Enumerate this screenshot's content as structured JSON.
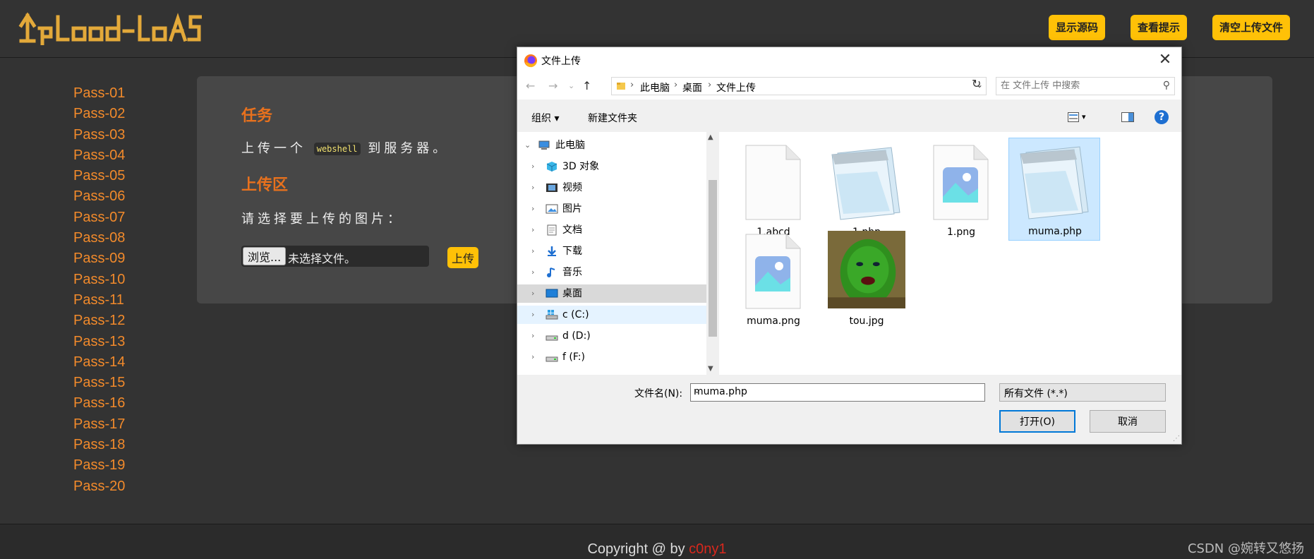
{
  "page": {
    "logo_text": "Upload-labs",
    "header_buttons": [
      "显示源码",
      "查看提示",
      "清空上传文件"
    ],
    "nav": [
      "Pass-01",
      "Pass-02",
      "Pass-03",
      "Pass-04",
      "Pass-05",
      "Pass-06",
      "Pass-07",
      "Pass-08",
      "Pass-09",
      "Pass-10",
      "Pass-11",
      "Pass-12",
      "Pass-13",
      "Pass-14",
      "Pass-15",
      "Pass-16",
      "Pass-17",
      "Pass-18",
      "Pass-19",
      "Pass-20"
    ],
    "task_heading": "任务",
    "task_before": "上传一个",
    "task_code": "webshell",
    "task_after": "到服务器。",
    "upload_heading": "上传区",
    "upload_prompt": "请选择要上传的图片：",
    "browse_label": "浏览...",
    "no_file": "未选择文件。",
    "upload_button": "上传",
    "copyright_prefix": "Copyright @  by ",
    "copyright_author": "c0ny1",
    "watermark": "CSDN @婉转又悠扬"
  },
  "dialog": {
    "title": "文件上传",
    "breadcrumb": [
      "此电脑",
      "桌面",
      "文件上传"
    ],
    "search_placeholder": "在 文件上传 中搜索",
    "toolbar": {
      "organize": "组织 ▾",
      "new_folder": "新建文件夹"
    },
    "tree": [
      {
        "label": "此电脑",
        "icon": "computer-icon",
        "level": 0,
        "state": ""
      },
      {
        "label": "3D 对象",
        "icon": "cube-icon",
        "level": 1,
        "state": ""
      },
      {
        "label": "视频",
        "icon": "video-icon",
        "level": 1,
        "state": ""
      },
      {
        "label": "图片",
        "icon": "picture-icon",
        "level": 1,
        "state": ""
      },
      {
        "label": "文档",
        "icon": "document-icon",
        "level": 1,
        "state": ""
      },
      {
        "label": "下载",
        "icon": "download-icon",
        "level": 1,
        "state": ""
      },
      {
        "label": "音乐",
        "icon": "music-icon",
        "level": 1,
        "state": ""
      },
      {
        "label": "桌面",
        "icon": "desktop-icon",
        "level": 1,
        "state": "selected"
      },
      {
        "label": "c (C:)",
        "icon": "windows-drive-icon",
        "level": 1,
        "state": "hover"
      },
      {
        "label": "d (D:)",
        "icon": "drive-icon",
        "level": 1,
        "state": ""
      },
      {
        "label": "f (F:)",
        "icon": "drive-icon",
        "level": 1,
        "state": ""
      }
    ],
    "files": [
      {
        "name": "1.abcd",
        "icon": "blank-file-icon",
        "selected": false
      },
      {
        "name": "1.php",
        "icon": "notepad-icon",
        "selected": false
      },
      {
        "name": "1.png",
        "icon": "image-file-icon",
        "selected": false
      },
      {
        "name": "muma.php",
        "icon": "notepad-icon",
        "selected": true
      },
      {
        "name": "muma.png",
        "icon": "image-file-icon",
        "selected": false
      },
      {
        "name": "tou.jpg",
        "icon": "photo-thumbnail",
        "selected": false
      }
    ],
    "filename_label": "文件名(N):",
    "filename_value": "muma.php",
    "filetype": "所有文件 (*.*)",
    "open_button": "打开(O)",
    "cancel_button": "取消"
  },
  "colors": {
    "accent": "#ffc107",
    "nav": "#f28a2b",
    "heading": "#e8711d",
    "author": "#d9281d",
    "selection": "#cce8ff"
  }
}
